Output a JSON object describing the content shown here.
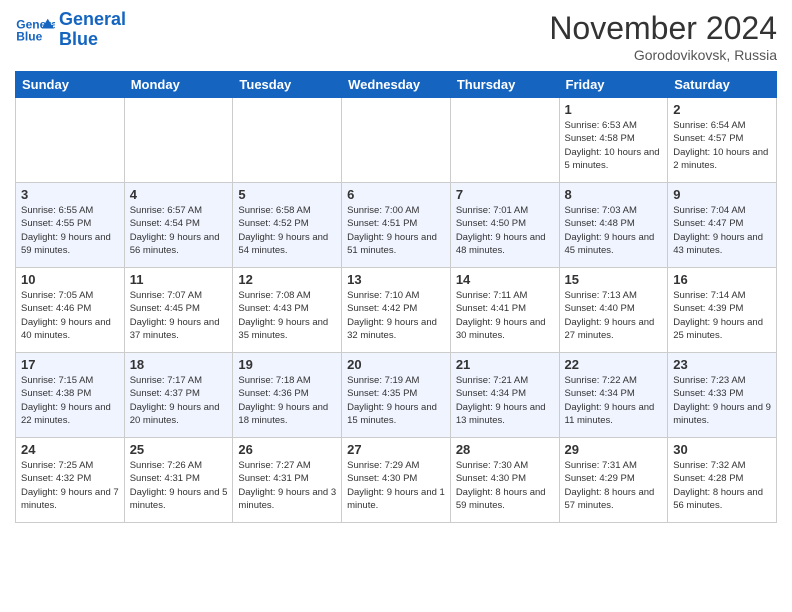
{
  "header": {
    "logo_line1": "General",
    "logo_line2": "Blue",
    "month_title": "November 2024",
    "location": "Gorodovikovsk, Russia"
  },
  "weekdays": [
    "Sunday",
    "Monday",
    "Tuesday",
    "Wednesday",
    "Thursday",
    "Friday",
    "Saturday"
  ],
  "weeks": [
    [
      {
        "day": "",
        "info": ""
      },
      {
        "day": "",
        "info": ""
      },
      {
        "day": "",
        "info": ""
      },
      {
        "day": "",
        "info": ""
      },
      {
        "day": "",
        "info": ""
      },
      {
        "day": "1",
        "info": "Sunrise: 6:53 AM\nSunset: 4:58 PM\nDaylight: 10 hours\nand 5 minutes."
      },
      {
        "day": "2",
        "info": "Sunrise: 6:54 AM\nSunset: 4:57 PM\nDaylight: 10 hours\nand 2 minutes."
      }
    ],
    [
      {
        "day": "3",
        "info": "Sunrise: 6:55 AM\nSunset: 4:55 PM\nDaylight: 9 hours\nand 59 minutes."
      },
      {
        "day": "4",
        "info": "Sunrise: 6:57 AM\nSunset: 4:54 PM\nDaylight: 9 hours\nand 56 minutes."
      },
      {
        "day": "5",
        "info": "Sunrise: 6:58 AM\nSunset: 4:52 PM\nDaylight: 9 hours\nand 54 minutes."
      },
      {
        "day": "6",
        "info": "Sunrise: 7:00 AM\nSunset: 4:51 PM\nDaylight: 9 hours\nand 51 minutes."
      },
      {
        "day": "7",
        "info": "Sunrise: 7:01 AM\nSunset: 4:50 PM\nDaylight: 9 hours\nand 48 minutes."
      },
      {
        "day": "8",
        "info": "Sunrise: 7:03 AM\nSunset: 4:48 PM\nDaylight: 9 hours\nand 45 minutes."
      },
      {
        "day": "9",
        "info": "Sunrise: 7:04 AM\nSunset: 4:47 PM\nDaylight: 9 hours\nand 43 minutes."
      }
    ],
    [
      {
        "day": "10",
        "info": "Sunrise: 7:05 AM\nSunset: 4:46 PM\nDaylight: 9 hours\nand 40 minutes."
      },
      {
        "day": "11",
        "info": "Sunrise: 7:07 AM\nSunset: 4:45 PM\nDaylight: 9 hours\nand 37 minutes."
      },
      {
        "day": "12",
        "info": "Sunrise: 7:08 AM\nSunset: 4:43 PM\nDaylight: 9 hours\nand 35 minutes."
      },
      {
        "day": "13",
        "info": "Sunrise: 7:10 AM\nSunset: 4:42 PM\nDaylight: 9 hours\nand 32 minutes."
      },
      {
        "day": "14",
        "info": "Sunrise: 7:11 AM\nSunset: 4:41 PM\nDaylight: 9 hours\nand 30 minutes."
      },
      {
        "day": "15",
        "info": "Sunrise: 7:13 AM\nSunset: 4:40 PM\nDaylight: 9 hours\nand 27 minutes."
      },
      {
        "day": "16",
        "info": "Sunrise: 7:14 AM\nSunset: 4:39 PM\nDaylight: 9 hours\nand 25 minutes."
      }
    ],
    [
      {
        "day": "17",
        "info": "Sunrise: 7:15 AM\nSunset: 4:38 PM\nDaylight: 9 hours\nand 22 minutes."
      },
      {
        "day": "18",
        "info": "Sunrise: 7:17 AM\nSunset: 4:37 PM\nDaylight: 9 hours\nand 20 minutes."
      },
      {
        "day": "19",
        "info": "Sunrise: 7:18 AM\nSunset: 4:36 PM\nDaylight: 9 hours\nand 18 minutes."
      },
      {
        "day": "20",
        "info": "Sunrise: 7:19 AM\nSunset: 4:35 PM\nDaylight: 9 hours\nand 15 minutes."
      },
      {
        "day": "21",
        "info": "Sunrise: 7:21 AM\nSunset: 4:34 PM\nDaylight: 9 hours\nand 13 minutes."
      },
      {
        "day": "22",
        "info": "Sunrise: 7:22 AM\nSunset: 4:34 PM\nDaylight: 9 hours\nand 11 minutes."
      },
      {
        "day": "23",
        "info": "Sunrise: 7:23 AM\nSunset: 4:33 PM\nDaylight: 9 hours\nand 9 minutes."
      }
    ],
    [
      {
        "day": "24",
        "info": "Sunrise: 7:25 AM\nSunset: 4:32 PM\nDaylight: 9 hours\nand 7 minutes."
      },
      {
        "day": "25",
        "info": "Sunrise: 7:26 AM\nSunset: 4:31 PM\nDaylight: 9 hours\nand 5 minutes."
      },
      {
        "day": "26",
        "info": "Sunrise: 7:27 AM\nSunset: 4:31 PM\nDaylight: 9 hours\nand 3 minutes."
      },
      {
        "day": "27",
        "info": "Sunrise: 7:29 AM\nSunset: 4:30 PM\nDaylight: 9 hours\nand 1 minute."
      },
      {
        "day": "28",
        "info": "Sunrise: 7:30 AM\nSunset: 4:30 PM\nDaylight: 8 hours\nand 59 minutes."
      },
      {
        "day": "29",
        "info": "Sunrise: 7:31 AM\nSunset: 4:29 PM\nDaylight: 8 hours\nand 57 minutes."
      },
      {
        "day": "30",
        "info": "Sunrise: 7:32 AM\nSunset: 4:28 PM\nDaylight: 8 hours\nand 56 minutes."
      }
    ]
  ]
}
